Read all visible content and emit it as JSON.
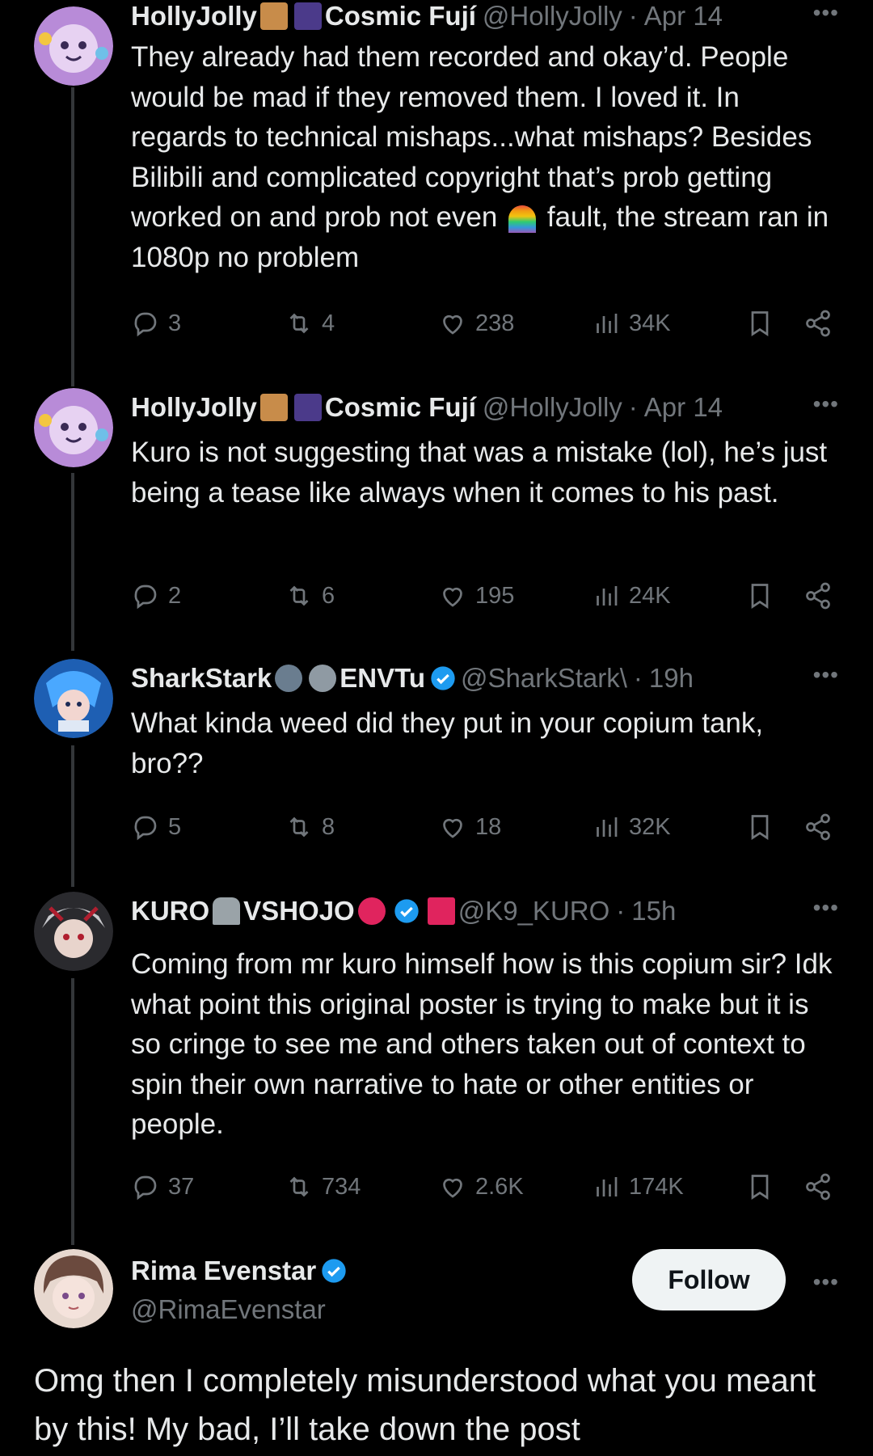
{
  "colors": {
    "background": "#000000",
    "text": "#e7e9ea",
    "muted": "#71767b",
    "verified": "#1d9bf0",
    "line": "#333639"
  },
  "replies": [
    {
      "name": "HollyJolly",
      "org": "Cosmic Fují",
      "handle": "@HollyJolly",
      "time": "Apr 14",
      "text": "They already had them recorded and okay’d. People would be mad if they removed them. I loved it. In regards to technical mishaps...what mishaps? Besides Bilibili and complicated copyright that’s prob getting worked on and prob not even",
      "text_after_emoji": "fault, the stream ran in 1080p no problem",
      "stats": {
        "replies": "3",
        "reposts": "4",
        "likes": "238",
        "views": "34K"
      }
    },
    {
      "name": "HollyJolly",
      "org": "Cosmic Fují",
      "handle": "@HollyJolly",
      "time": "Apr 14",
      "text": "Kuro is not suggesting that was a mistake (lol), he’s just being a tease like always when it comes to his past.",
      "stats": {
        "replies": "2",
        "reposts": "6",
        "likes": "195",
        "views": "24K"
      }
    },
    {
      "name": "SharkStark",
      "org": "ENVTu",
      "handle": "@SharkStark\\",
      "time": "19h",
      "text": "What kinda weed did they put in your copium tank, bro??",
      "stats": {
        "replies": "5",
        "reposts": "8",
        "likes": "18",
        "views": "32K"
      }
    },
    {
      "name": "KURO",
      "org": "VSHOJO",
      "handle": "@K9_KURO",
      "time": "15h",
      "text": "Coming from mr kuro himself how is this copium sir? Idk what point this original poster is trying to make but it is so cringe to see me and others taken out of context to spin their own narrative to hate or other entities or people.",
      "stats": {
        "replies": "37",
        "reposts": "734",
        "likes": "2.6K",
        "views": "174K"
      }
    }
  ],
  "main": {
    "name": "Rima Evenstar",
    "handle": "@RimaEvenstar",
    "follow_label": "Follow",
    "text": "Omg then I completely misunderstood what you meant by this! My bad, I’ll take down the post"
  },
  "icons": [
    "reply-icon",
    "repost-icon",
    "like-icon",
    "views-icon",
    "bookmark-icon",
    "share-icon",
    "more-icon",
    "verified-icon"
  ]
}
